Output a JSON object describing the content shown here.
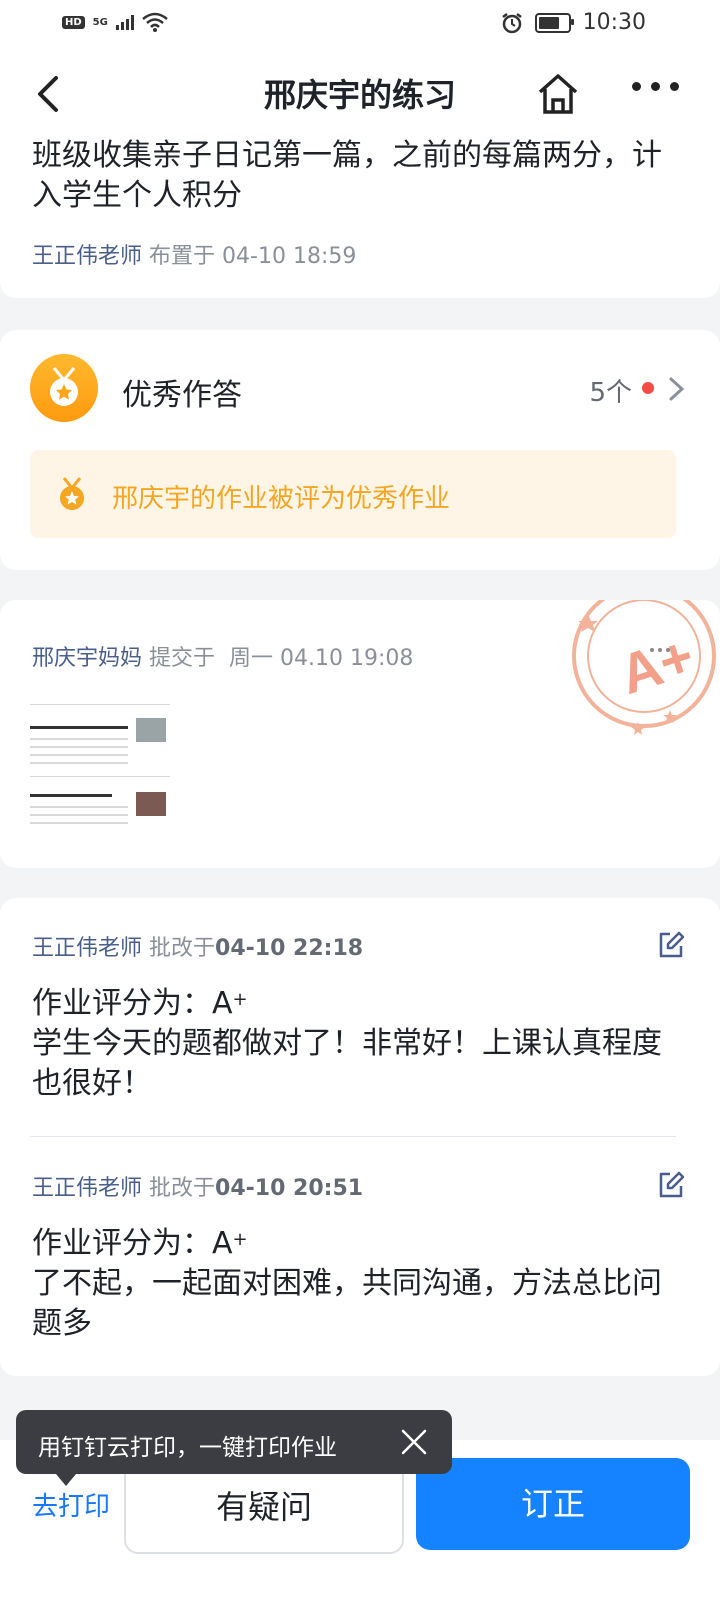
{
  "status_bar": {
    "network_badge": "HD",
    "network_type": "5G",
    "time": "10:30",
    "icons": [
      "signal-icon",
      "wifi-icon",
      "alarm-icon",
      "battery-icon"
    ]
  },
  "nav": {
    "title": "邢庆宇的练习",
    "icons": [
      "back-icon",
      "home-icon",
      "more-icon"
    ]
  },
  "assignment": {
    "text": "班级收集亲子日记第一篇，之前的每篇两分，计入学生个人积分",
    "teacher": "王正伟老师",
    "assigned_prefix": "布置于",
    "assigned_time": "04-10 18:59"
  },
  "excellent": {
    "title": "优秀作答",
    "count": "5个",
    "notice": "邢庆宇的作业被评为优秀作业",
    "accent_color": "#f5a623"
  },
  "submission": {
    "submitter": "邢庆宇妈妈",
    "submitted_prefix": "提交于",
    "submitted_time": "周一 04.10 19:08",
    "grade_stamp": "A+"
  },
  "reviews": [
    {
      "teacher": "王正伟老师",
      "action": "批改于",
      "time": "04-10 22:18",
      "score_label": "作业评分为：",
      "grade": "A",
      "grade_sup": "+",
      "comment": "学生今天的题都做对了！非常好！上课认真程度也很好！"
    },
    {
      "teacher": "王正伟老师",
      "action": "批改于",
      "time": "04-10 20:51",
      "score_label": "作业评分为：",
      "grade": "A",
      "grade_sup": "+",
      "comment": "了不起，一起面对困难，共同沟通，方法总比问题多"
    }
  ],
  "tooltip": {
    "text": "用钉钉云打印，一键打印作业"
  },
  "bottom": {
    "print_label": "去打印",
    "question_label": "有疑问",
    "correct_label": "订正",
    "primary_color": "#1582ff"
  }
}
